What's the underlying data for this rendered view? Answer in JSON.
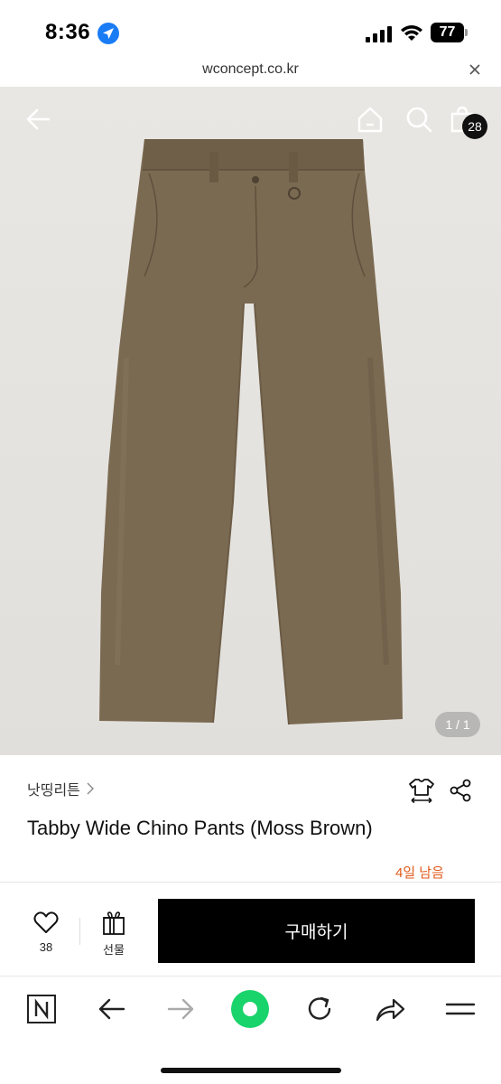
{
  "status_bar": {
    "time": "8:36",
    "battery": "77"
  },
  "url_bar": {
    "url": "wconcept.co.kr"
  },
  "product_image": {
    "cart_count": "28",
    "page_indicator": "1 / 1"
  },
  "product": {
    "brand": "낫띵리튼",
    "title": "Tabby Wide Chino Pants (Moss Brown)",
    "days_left": "4일 남음"
  },
  "actions": {
    "like_count": "38",
    "gift_label": "선물",
    "buy_label": "구매하기"
  },
  "colors": {
    "accent_orange": "#e05a1a",
    "pants": "#7b6a52",
    "buy_button": "#000000",
    "browser_green": "#19d36b"
  },
  "icons": [
    "location-arrow-icon",
    "signal-icon",
    "wifi-icon",
    "battery-icon",
    "close-icon",
    "back-arrow-icon",
    "home-icon",
    "search-icon",
    "shopping-bag-icon",
    "chevron-right-icon",
    "size-guide-icon",
    "share-icon",
    "heart-icon",
    "gift-icon",
    "naver-icon",
    "browser-back-icon",
    "browser-forward-icon",
    "green-dot-icon",
    "refresh-icon",
    "share-arrow-icon",
    "menu-icon"
  ]
}
